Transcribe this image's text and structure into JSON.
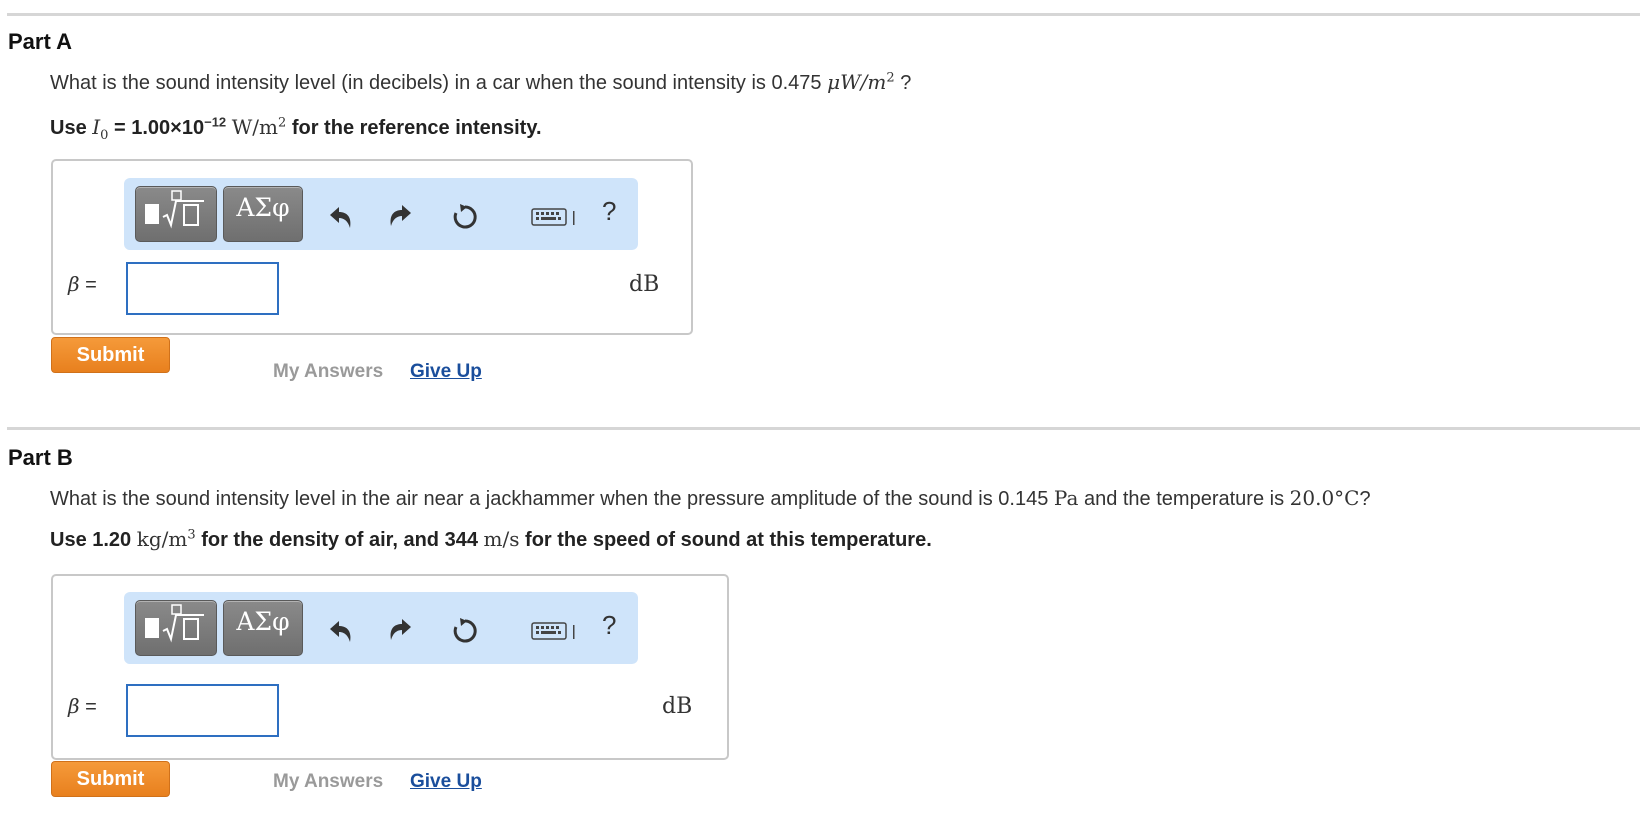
{
  "partA": {
    "title": "Part A",
    "question_prefix": "What is the sound intensity level (in decibels) in a car when the sound intensity is 0.475",
    "question_unit": "μW/m",
    "question_unit_exp": "2",
    "question_suffix": "?",
    "hint_use": "Use",
    "hint_symbol": "I",
    "hint_symbol_sub": "0",
    "hint_value": "= 1.00×10",
    "hint_exp": "−12",
    "hint_unit": "W/m",
    "hint_unit_exp": "2",
    "hint_suffix": "for the reference intensity.",
    "variable_label": "β",
    "equals": "=",
    "input_value": "",
    "unit": "dB",
    "submit_label": "Submit",
    "my_answers_label": "My Answers",
    "give_up_label": "Give Up"
  },
  "partB": {
    "title": "Part B",
    "question_prefix": "What is the sound intensity level in the air near a jackhammer when the pressure amplitude of the sound is 0.145",
    "question_unit1": "Pa",
    "question_mid": "and the temperature is",
    "question_temp": "20.0°",
    "question_unit2": "C",
    "question_suffix": "?",
    "hint_prefix": "Use 1.20",
    "hint_unit1": "kg/m",
    "hint_unit1_exp": "3",
    "hint_mid": "for the density of air, and 344",
    "hint_unit2": "m/s",
    "hint_suffix": "for the speed of sound at this temperature.",
    "variable_label": "β",
    "equals": "=",
    "input_value": "",
    "unit": "dB",
    "submit_label": "Submit",
    "my_answers_label": "My Answers",
    "give_up_label": "Give Up"
  },
  "toolbar": {
    "template_symbol_2": "ΑΣφ",
    "help_label": "?"
  },
  "colors": {
    "accent_orange": "#e8801e",
    "link_blue": "#1a4e9c",
    "toolbar_bg": "#cfe4fa",
    "input_border": "#2e6fc1"
  }
}
